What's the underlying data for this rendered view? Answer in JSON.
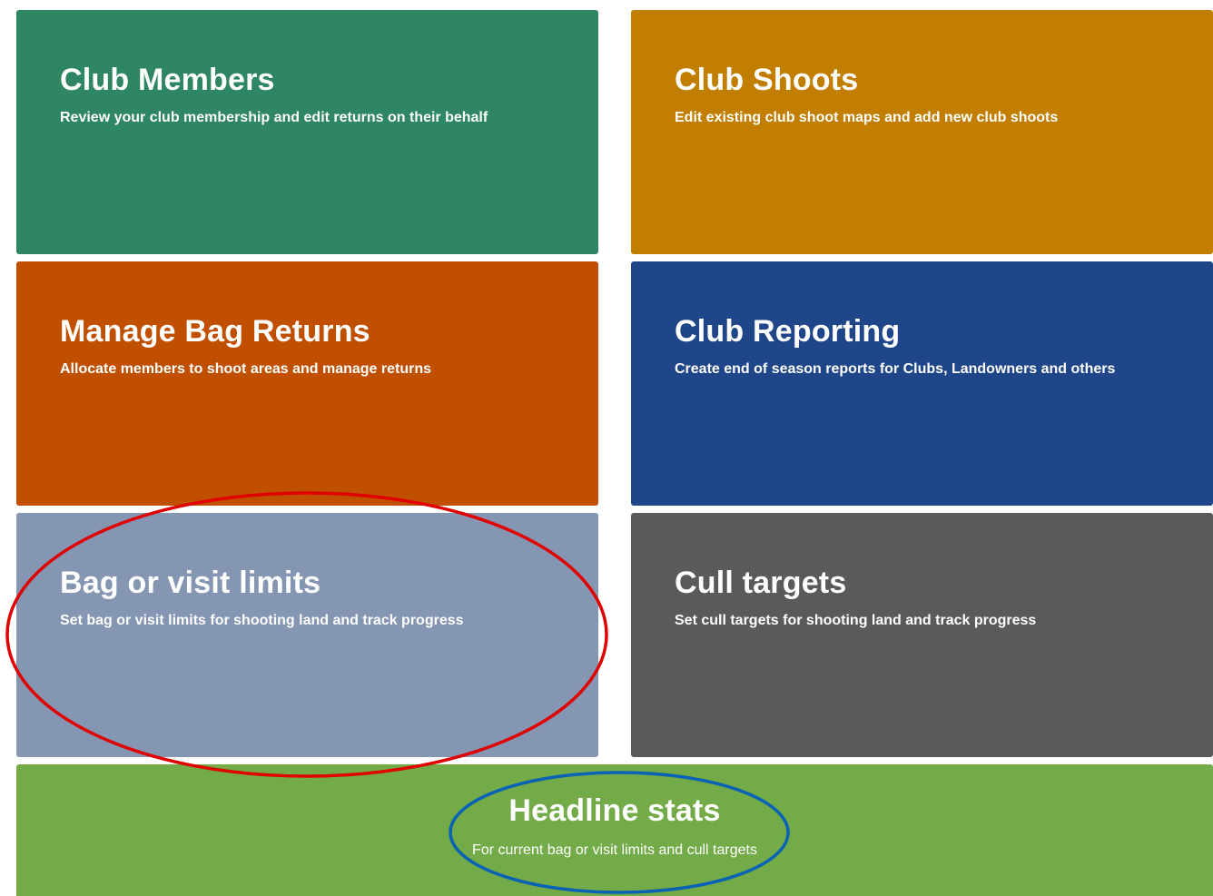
{
  "tiles": {
    "club_members": {
      "title": "Club Members",
      "description": "Review your club membership and edit returns on their behalf",
      "color": "#2e8662"
    },
    "club_shoots": {
      "title": "Club Shoots",
      "description": "Edit existing club shoot maps and add new club shoots",
      "color": "#c17e00"
    },
    "manage_bag_returns": {
      "title": "Manage Bag Returns",
      "description": "Allocate members to shoot areas and manage returns",
      "color": "#c04f00"
    },
    "club_reporting": {
      "title": "Club Reporting",
      "description": "Create end of season reports for Clubs, Landowners and others",
      "color": "#1f4688"
    },
    "bag_or_visit_limits": {
      "title": "Bag or visit limits",
      "description": "Set bag or visit limits for shooting land and track progress",
      "color": "#8496b1"
    },
    "cull_targets": {
      "title": "Cull targets",
      "description": "Set cull targets for shooting land and track progress",
      "color": "#5a5a5a"
    },
    "headline_stats": {
      "title": "Headline stats",
      "description": "For current bag or visit limits and cull targets",
      "color": "#72ab47"
    }
  },
  "annotations": {
    "red_ellipse_color": "#e00000",
    "blue_ellipse_color": "#0a62b4"
  }
}
